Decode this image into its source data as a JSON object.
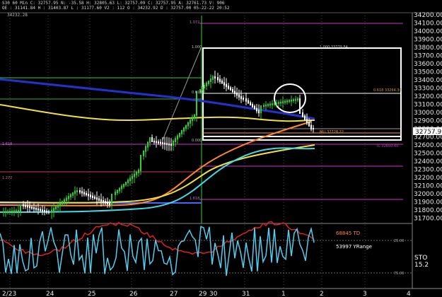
{
  "header": {
    "symbol": "S30",
    "timeframe": "60 Min",
    "close_label": "C: 32757.95",
    "move_label": "N: -35.58",
    "high_label": "H: 32805.63",
    "low_label": "L: 32757.09",
    "close2_label": "C: 32757.95",
    "ask_label": "A: 32761.73",
    "vol_label": "V: 906",
    "row2": "OE : 31141.84  H : 31403.87  L : 31177.60  V2 : 112  O : 34232.92  D : 32757.00  05-22-22  20:52"
  },
  "subtitle": "34232.28",
  "price_axis": {
    "labels": [
      "34200.00",
      "34100.00",
      "34000.00",
      "33900.00",
      "33800.00",
      "33700.00",
      "33600.00",
      "33500.00",
      "33400.00",
      "33300.00",
      "33200.00",
      "33100.00",
      "33000.00",
      "32900.00",
      "32800.00",
      "32700.00",
      "32600.00",
      "32500.00",
      "32400.00",
      "32300.00",
      "32200.00",
      "32100.00",
      "32000.00",
      "31900.00",
      "31800.00",
      "31700.00"
    ],
    "current_price": "32757.95"
  },
  "time_axis": {
    "labels": [
      "2/23",
      "24",
      "25",
      "26",
      "27",
      "29",
      "30",
      "31",
      "1",
      "2",
      "3",
      "4"
    ]
  },
  "fib_labels": {
    "top": "1.072",
    "box_top": "1.000",
    "mid": "0.618",
    "mid_right": "0.618  33264.34",
    "box_low": "0.000",
    "lower_left": "1.618",
    "lower2": "1.272",
    "lower3": "1.618",
    "box_top_right": "1.000  33779.84",
    "mli": "MLI 32728.22",
    "green_right": "TL 32650.40"
  },
  "indicator": {
    "td_label": "68845 TD",
    "yrange_label": "53997 YRange",
    "sto_label": "STO",
    "sto_value": "15.2",
    "level_upper": "25.00",
    "level_lower": "75.00"
  },
  "colors": {
    "bg": "#000000",
    "candle": "#ffffff",
    "green_candle": "#33cc33",
    "blue_ma": "#2233cc",
    "yellow_ma": "#f0e040",
    "orange_ma": "#ff8833",
    "cyan_ma": "#44d8e8",
    "magenta_line": "#cc33cc",
    "box": "#ffffff",
    "sto_blue": "#55ccee",
    "sto_red": "#dd2222"
  }
}
